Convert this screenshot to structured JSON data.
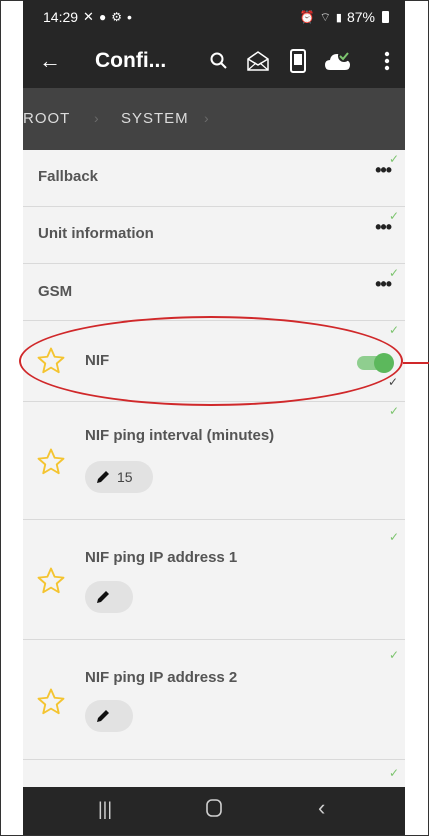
{
  "status_bar": {
    "time": "14:29",
    "left_icons": [
      "missed-call-icon",
      "timer-icon",
      "settings-icon"
    ],
    "dot": "•",
    "battery": "87%",
    "right_icons": [
      "alarm-icon",
      "wifi-icon",
      "signal-icon",
      "battery-icon"
    ]
  },
  "app_bar": {
    "back_icon": "arrow-left-icon",
    "title": "Confi...",
    "actions": [
      "search-icon",
      "mail-icon",
      "phone-device-icon",
      "cloud-check-icon",
      "more-vert-icon"
    ]
  },
  "breadcrumb": {
    "items": [
      "ROOT",
      "SYSTEM"
    ]
  },
  "list": {
    "groups": [
      {
        "label": "Fallback"
      },
      {
        "label": "Unit information"
      },
      {
        "label": "GSM"
      }
    ],
    "nif": {
      "label": "NIF",
      "enabled": true
    },
    "settings": [
      {
        "label": "NIF ping interval (minutes)",
        "value": "15"
      },
      {
        "label": "NIF ping IP address 1",
        "value": ""
      },
      {
        "label": "NIF ping IP address 2",
        "value": ""
      }
    ]
  },
  "colors": {
    "bar": "#262626",
    "breadcrumb": "#434343",
    "accent_green": "#5cb85c",
    "check_green": "#7cc46e",
    "star_yellow": "#f4c430",
    "highlight_red": "#d0282a"
  }
}
